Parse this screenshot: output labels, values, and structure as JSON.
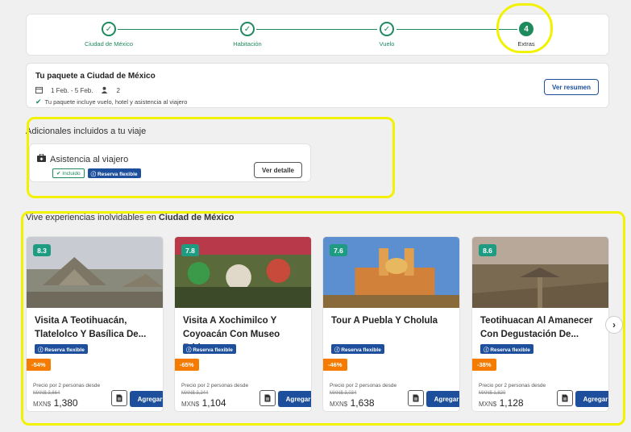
{
  "stepper": {
    "steps": [
      {
        "label": "Ciudad de México",
        "mark": "✓"
      },
      {
        "label": "Habitación",
        "mark": "✓"
      },
      {
        "label": "Vuelo",
        "mark": "✓"
      },
      {
        "label": "Extras",
        "mark": "4"
      }
    ]
  },
  "summary": {
    "title": "Tu paquete a Ciudad de México",
    "dates": "1 Feb. - 5 Feb.",
    "travelers": "2",
    "note": "Tu paquete incluye vuelo, hotel y asistencia al viajero",
    "button": "Ver resumen"
  },
  "included": {
    "section_title": "Adicionales incluidos a tu viaje",
    "name": "Asistencia al viajero",
    "badge_included": "Incluido",
    "badge_flexible": "Reserva flexible",
    "button": "Ver detalle"
  },
  "experiences": {
    "section_prefix": "Vive experiencias inolvidables en ",
    "section_city": "Ciudad de México",
    "flexible_label": "Reserva flexible",
    "from_label": "Precio por 2 personas desde",
    "currency": "MXN$",
    "add_label": "Agregar",
    "items": [
      {
        "score": "8.3",
        "title": "Visita A Teotihuacán, Tlatelolco Y Basílica De...",
        "discount": "-54%",
        "old_price": "MXN$ 3,664",
        "price": "1,380"
      },
      {
        "score": "7.8",
        "title": "Visita A Xochimilco Y Coyoacán Con Museo Frid...",
        "discount": "-65%",
        "old_price": "MXN$ 3,244",
        "price": "1,104"
      },
      {
        "score": "7.6",
        "title": "Tour A Puebla Y Cholula",
        "discount": "-46%",
        "old_price": "MXN$ 3,034",
        "price": "1,638"
      },
      {
        "score": "8.6",
        "title": "Teotihuacan Al Amanecer Con Degustación De...",
        "discount": "-38%",
        "old_price": "MXN$ 1,820",
        "price": "1,128"
      }
    ]
  },
  "icons": {
    "calendar": "calendar-icon",
    "person": "person-icon",
    "check": "check-icon",
    "suitcase": "suitcase-icon",
    "info": "info-icon",
    "document": "document-icon",
    "next": "chevron-right-icon"
  },
  "colors": {
    "primary": "#1d4f9c",
    "success": "#1e8a5e",
    "discount": "#f57c00",
    "score": "#1e9c82",
    "highlight": "#f2f200"
  }
}
